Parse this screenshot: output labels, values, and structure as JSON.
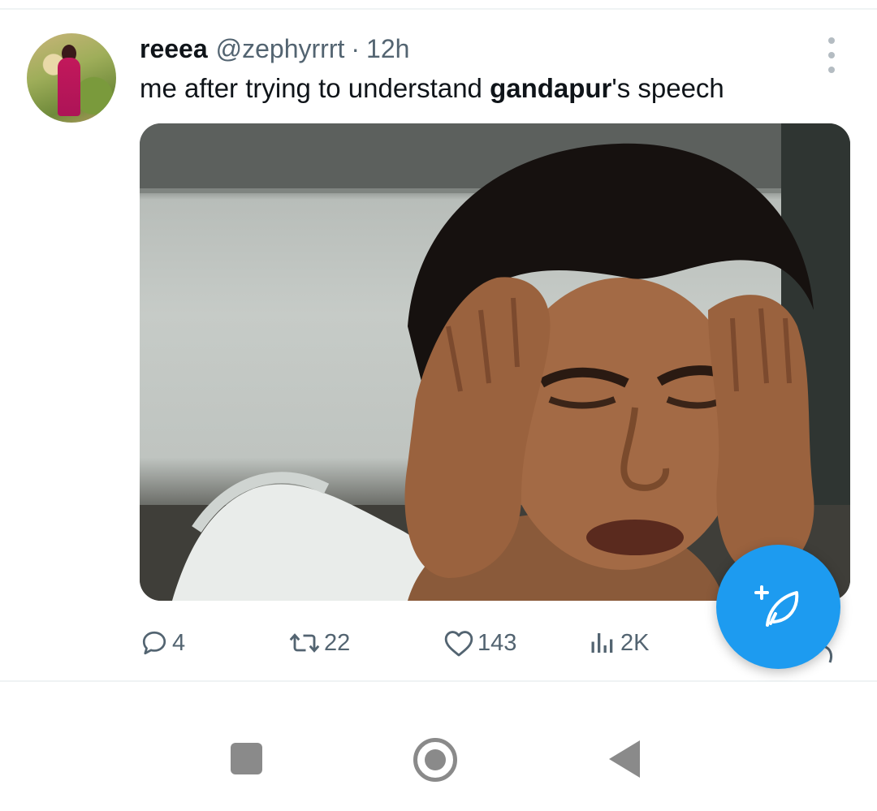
{
  "tweet": {
    "display_name": "reeea",
    "handle": "@zephyrrrt",
    "separator": "·",
    "time": "12h",
    "text_before": "me after trying to understand ",
    "text_bold": "gandapur",
    "text_after": "'s speech",
    "actions": {
      "reply_count": "4",
      "retweet_count": "22",
      "like_count": "143",
      "views_count": "2K"
    }
  },
  "colors": {
    "accent": "#1d9bf0",
    "secondary_text": "#536471",
    "nav_icon": "#8a8a8a"
  },
  "icons": {
    "more": "more-vertical-icon",
    "reply": "reply-icon",
    "retweet": "retweet-icon",
    "like": "heart-icon",
    "views": "views-icon",
    "compose": "compose-tweet-icon",
    "nav_recents": "square-icon",
    "nav_home": "circle-icon",
    "nav_back": "back-triangle-icon"
  }
}
